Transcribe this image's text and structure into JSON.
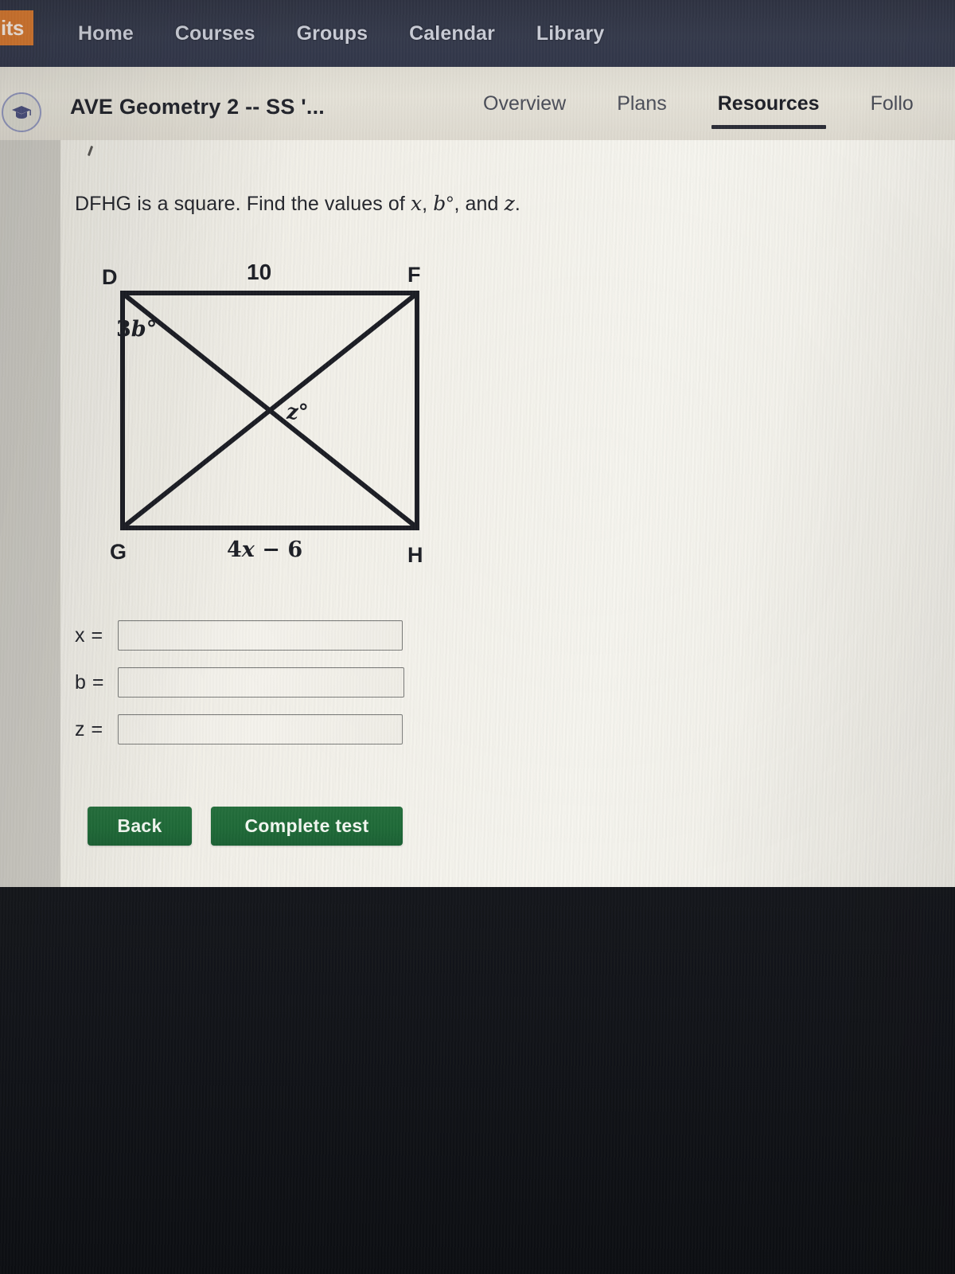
{
  "topnav": {
    "brand_label": "its",
    "brand_color": "#d2762f",
    "bar_color": "#353a4b",
    "links": [
      {
        "label": "Home"
      },
      {
        "label": "Courses"
      },
      {
        "label": "Groups"
      },
      {
        "label": "Calendar"
      },
      {
        "label": "Library"
      }
    ]
  },
  "coursebar": {
    "avatar_icon": "graduation-cap-icon",
    "title": "AVE Geometry 2 -- SS '...",
    "bar_color": "#ddd9cf",
    "tabs": [
      {
        "label": "Overview",
        "active": false
      },
      {
        "label": "Plans",
        "active": false
      },
      {
        "label": "Resources",
        "active": true
      },
      {
        "label": "Follo",
        "active": false
      }
    ]
  },
  "question": {
    "prefix": "DFHG is a square.  Find the values of ",
    "var1": "x",
    "sep1": ", ",
    "var2": "b",
    "degree": "°",
    "sep2": ", and ",
    "var3": "z",
    "suffix": "."
  },
  "figure": {
    "type": "square-with-diagonals",
    "vertices": {
      "top_left": "D",
      "top_right": "F",
      "bottom_left": "G",
      "bottom_right": "H"
    },
    "labels": {
      "top_side": "10",
      "bottom_side_coef": "4",
      "bottom_side_var": "x",
      "bottom_side_rest": " − 6",
      "bottom_side_full": "4x − 6",
      "angle_at_D_coef": "3",
      "angle_at_D_var": "b",
      "angle_at_D_deg": "°",
      "angle_center_var": "z",
      "angle_center_deg": "°"
    },
    "stroke_color": "#1b1d24"
  },
  "answers": {
    "fields": [
      {
        "label": "x =",
        "value": "",
        "placeholder": ""
      },
      {
        "label": "b =",
        "value": "",
        "placeholder": ""
      },
      {
        "label": "z =",
        "value": "",
        "placeholder": ""
      }
    ]
  },
  "buttons": {
    "back_label": "Back",
    "complete_label": "Complete test",
    "accent_color": "#1f6a38"
  }
}
